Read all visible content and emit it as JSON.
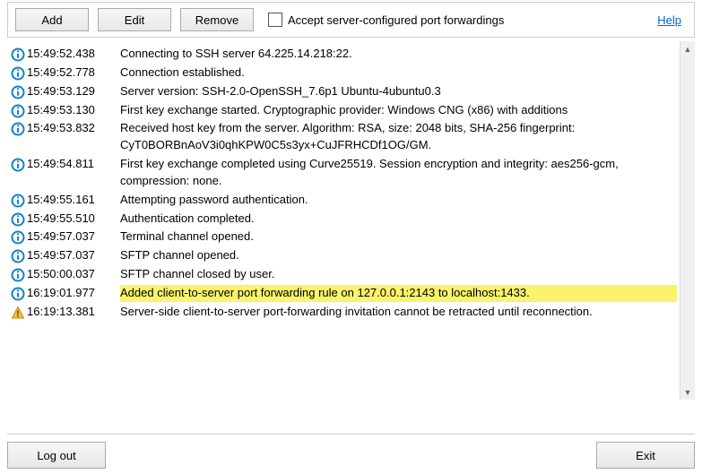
{
  "toolbar": {
    "add_label": "Add",
    "edit_label": "Edit",
    "remove_label": "Remove",
    "accept_label": "Accept server-configured port forwardings",
    "help_label": "Help"
  },
  "log": [
    {
      "icon": "info",
      "ts": "15:49:52.438",
      "msg": "Connecting to SSH server 64.225.14.218:22.",
      "hl": false
    },
    {
      "icon": "info",
      "ts": "15:49:52.778",
      "msg": "Connection established.",
      "hl": false
    },
    {
      "icon": "info",
      "ts": "15:49:53.129",
      "msg": "Server version: SSH-2.0-OpenSSH_7.6p1 Ubuntu-4ubuntu0.3",
      "hl": false
    },
    {
      "icon": "info",
      "ts": "15:49:53.130",
      "msg": "First key exchange started. Cryptographic provider: Windows CNG (x86) with additions",
      "hl": false
    },
    {
      "icon": "info",
      "ts": "15:49:53.832",
      "msg": "Received host key from the server. Algorithm: RSA, size: 2048 bits, SHA-256 fingerprint: CyT0BORBnAoV3i0qhKPW0C5s3yx+CuJFRHCDf1OG/GM.",
      "hl": false
    },
    {
      "icon": "info",
      "ts": "15:49:54.811",
      "msg": "First key exchange completed using Curve25519. Session encryption and integrity: aes256-gcm, compression: none.",
      "hl": false
    },
    {
      "icon": "info",
      "ts": "15:49:55.161",
      "msg": "Attempting password authentication.",
      "hl": false
    },
    {
      "icon": "info",
      "ts": "15:49:55.510",
      "msg": "Authentication completed.",
      "hl": false
    },
    {
      "icon": "info",
      "ts": "15:49:57.037",
      "msg": "Terminal channel opened.",
      "hl": false
    },
    {
      "icon": "info",
      "ts": "15:49:57.037",
      "msg": "SFTP channel opened.",
      "hl": false
    },
    {
      "icon": "info",
      "ts": "15:50:00.037",
      "msg": "SFTP channel closed by user.",
      "hl": false
    },
    {
      "icon": "info",
      "ts": "16:19:01.977",
      "msg": "Added client-to-server port forwarding rule on 127.0.0.1:2143 to localhost:1433.",
      "hl": true
    },
    {
      "icon": "warn",
      "ts": "16:19:13.381",
      "msg": "Server-side client-to-server port-forwarding invitation cannot be retracted until reconnection.",
      "hl": false
    }
  ],
  "footer": {
    "logout_label": "Log out",
    "exit_label": "Exit"
  }
}
